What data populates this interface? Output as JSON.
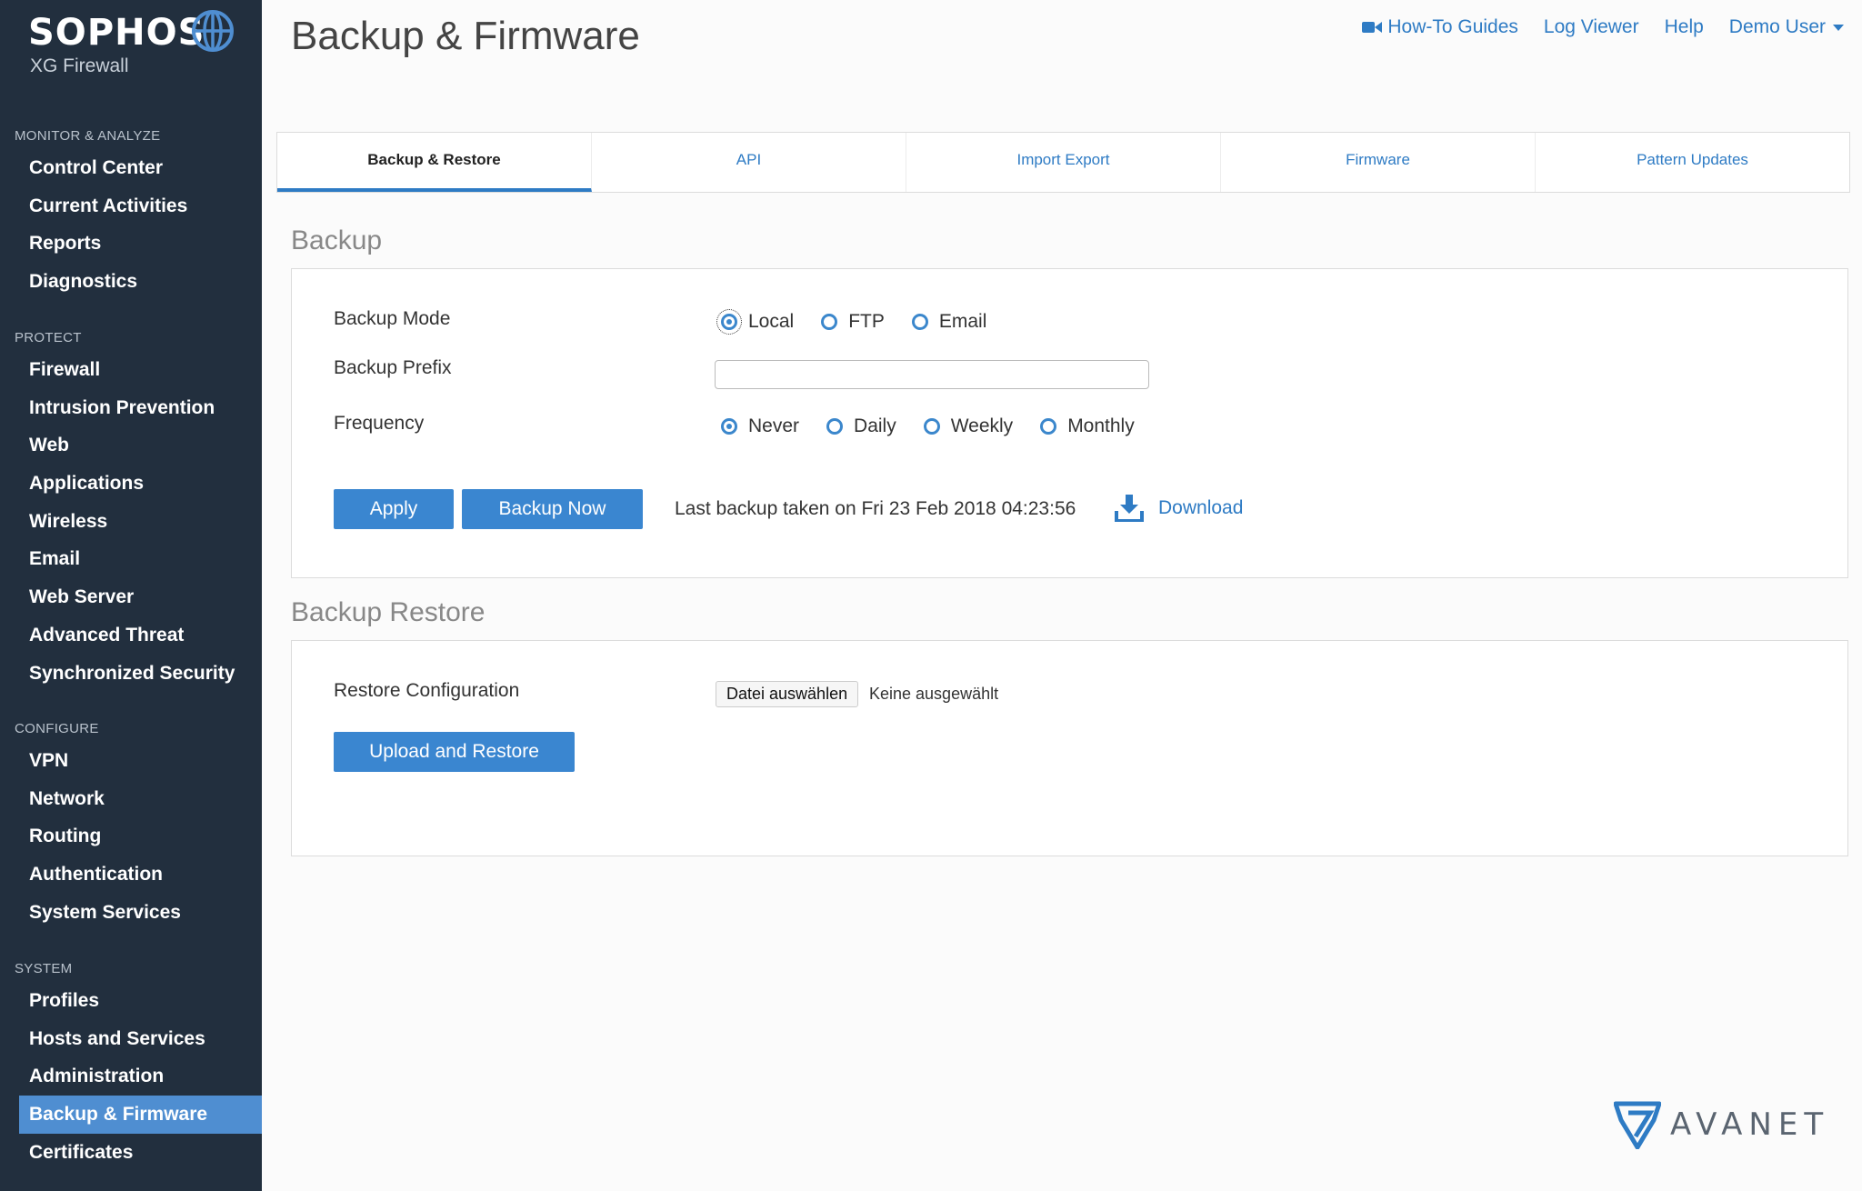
{
  "brand": {
    "name": "SOPHOS",
    "subtitle": "XG Firewall"
  },
  "sidebar": {
    "groups": [
      {
        "title": "MONITOR & ANALYZE",
        "items": [
          "Control Center",
          "Current Activities",
          "Reports",
          "Diagnostics"
        ]
      },
      {
        "title": "PROTECT",
        "items": [
          "Firewall",
          "Intrusion Prevention",
          "Web",
          "Applications",
          "Wireless",
          "Email",
          "Web Server",
          "Advanced Threat",
          "Synchronized Security"
        ]
      },
      {
        "title": "CONFIGURE",
        "items": [
          "VPN",
          "Network",
          "Routing",
          "Authentication",
          "System Services"
        ]
      },
      {
        "title": "SYSTEM",
        "items": [
          "Profiles",
          "Hosts and Services",
          "Administration",
          "Backup & Firmware",
          "Certificates"
        ]
      }
    ],
    "active_item": "Backup & Firmware"
  },
  "header": {
    "title": "Backup & Firmware",
    "links": {
      "how_to": "How-To Guides",
      "log_viewer": "Log Viewer",
      "help": "Help",
      "user": "Demo User"
    }
  },
  "tabs": [
    "Backup & Restore",
    "API",
    "Import Export",
    "Firmware",
    "Pattern Updates"
  ],
  "active_tab": "Backup & Restore",
  "backup": {
    "section_title": "Backup",
    "mode_label": "Backup Mode",
    "mode_options": [
      "Local",
      "FTP",
      "Email"
    ],
    "mode_selected": "Local",
    "prefix_label": "Backup Prefix",
    "prefix_value": "",
    "frequency_label": "Frequency",
    "frequency_options": [
      "Never",
      "Daily",
      "Weekly",
      "Monthly"
    ],
    "frequency_selected": "Never",
    "apply_label": "Apply",
    "backup_now_label": "Backup Now",
    "last_backup_text": "Last backup taken on Fri 23 Feb 2018 04:23:56",
    "download_label": "Download"
  },
  "restore": {
    "section_title": "Backup Restore",
    "config_label": "Restore Configuration",
    "file_button": "Datei auswählen",
    "file_status": "Keine ausgewählt",
    "upload_label": "Upload and Restore"
  },
  "watermark": {
    "text": "AVANET"
  },
  "colors": {
    "sidebar_bg": "#222f3e",
    "accent": "#3a86d0",
    "active_nav": "#4f8ed1"
  }
}
